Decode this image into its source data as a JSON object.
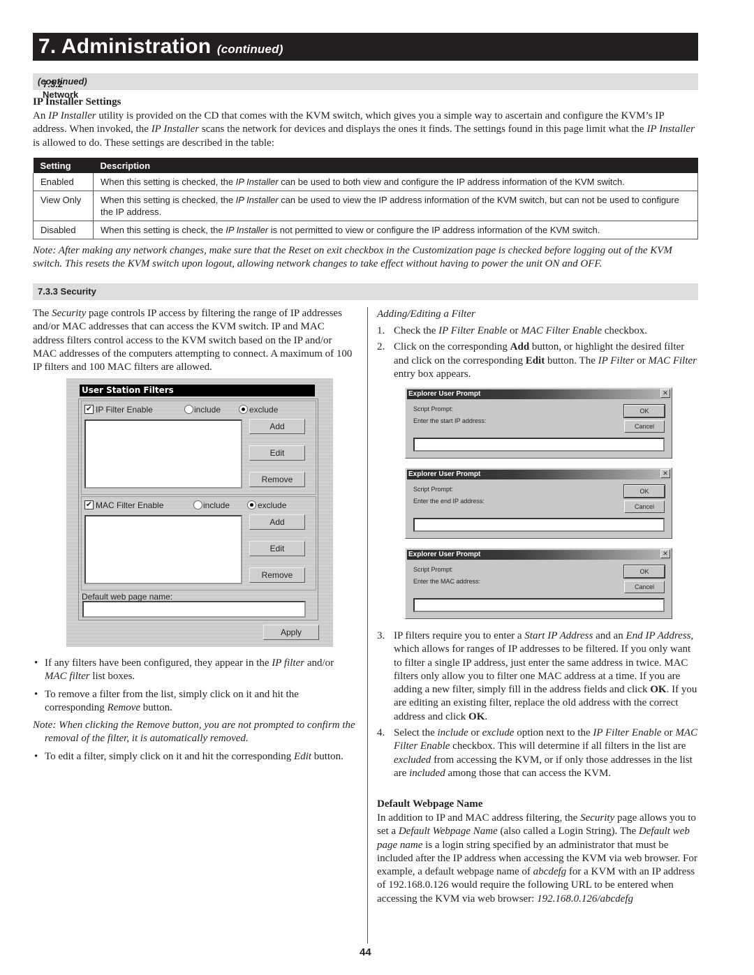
{
  "chapter": {
    "title": "7. Administration",
    "continued": "(continued)"
  },
  "network_section": {
    "number_label": "7.3.2 Network",
    "continued": "(continued)"
  },
  "ip_installer": {
    "heading": "IP Installer Settings",
    "intro": [
      {
        "t": "An "
      },
      {
        "t": "IP Installer",
        "i": true
      },
      {
        "t": " utility is provided on the CD that comes with the KVM switch, which gives you a simple way to ascertain and configure the KVM’s IP address. When invoked, the "
      },
      {
        "t": "IP Installer",
        "i": true
      },
      {
        "t": " scans the network for devices and displays the ones it finds. The settings found in this page limit what the "
      },
      {
        "t": "IP Installer",
        "i": true
      },
      {
        "t": " is allowed to do. These settings are described in the table:"
      }
    ],
    "table": {
      "headers": [
        "Setting",
        "Description"
      ],
      "rows": [
        {
          "setting": "Enabled",
          "desc": [
            {
              "t": "When this setting is checked, the "
            },
            {
              "t": "IP Installer",
              "i": true
            },
            {
              "t": " can be used to both view and configure the IP address information of the KVM switch."
            }
          ]
        },
        {
          "setting": "View Only",
          "desc": [
            {
              "t": "When this setting is checked, the "
            },
            {
              "t": "IP Installer",
              "i": true
            },
            {
              "t": " can be used to view the IP address information of the KVM switch, but can not be used to configure the IP address."
            }
          ]
        },
        {
          "setting": "Disabled",
          "desc": [
            {
              "t": "When this setting is check, the "
            },
            {
              "t": "IP Installer",
              "i": true
            },
            {
              "t": " is not permitted to view or configure the IP address information of the KVM switch."
            }
          ]
        }
      ]
    },
    "note": "Note: After making any network changes, make sure that the Reset on exit checkbox in the Customization page is checked before logging out of the KVM switch. This resets the KVM switch upon logout, allowing network changes to take effect without having to power the unit ON and OFF."
  },
  "security_section": {
    "number_label": "7.3.3 Security",
    "intro": [
      {
        "t": "The "
      },
      {
        "t": "Security",
        "i": true
      },
      {
        "t": " page controls IP access by filtering the range of IP addresses and/or MAC addresses that can access the KVM switch. IP and MAC address filters control access to the KVM switch based on the IP and/or MAC addresses of the computers attempting to connect. A maximum of 100 IP filters and 100 MAC filters are allowed."
      }
    ],
    "filters_panel": {
      "title": "User Station Filters",
      "ip": {
        "label": "IP Filter Enable",
        "checked": true,
        "include_label": "include",
        "exclude_label": "exclude",
        "selected": "exclude"
      },
      "mac": {
        "label": "MAC Filter Enable",
        "checked": true,
        "include_label": "include",
        "exclude_label": "exclude",
        "selected": "exclude"
      },
      "buttons": {
        "add": "Add",
        "edit": "Edit",
        "remove": "Remove",
        "apply": "Apply"
      },
      "check_mark": "✔",
      "web_page_label": "Default web page name:",
      "web_page_value": ""
    },
    "bullets": [
      [
        {
          "t": "If any filters have been configured, they appear in the "
        },
        {
          "t": "IP filter",
          "i": true
        },
        {
          "t": " and/or "
        },
        {
          "t": "MAC filter",
          "i": true
        },
        {
          "t": " list boxes."
        }
      ],
      [
        {
          "t": "To remove a filter from the list, simply click on it and hit the corresponding "
        },
        {
          "t": "Remove",
          "i": true
        },
        {
          "t": " button."
        }
      ]
    ],
    "remove_note": "Note: When clicking the Remove button, you are not prompted to confirm the removal of the filter, it is automatically removed.",
    "edit_bullet": [
      {
        "t": "To edit a filter, simply click on it and hit the corresponding "
      },
      {
        "t": "Edit",
        "i": true
      },
      {
        "t": " button."
      }
    ],
    "adding_heading": "Adding/Editing a Filter",
    "steps": [
      {
        "num": "1.",
        "text": [
          {
            "t": "Check the "
          },
          {
            "t": "IP Filter Enable",
            "i": true
          },
          {
            "t": " or "
          },
          {
            "t": "MAC Filter Enable",
            "i": true
          },
          {
            "t": " checkbox."
          }
        ]
      },
      {
        "num": "2.",
        "text": [
          {
            "t": "Click on the corresponding "
          },
          {
            "t": "Add",
            "b": true
          },
          {
            "t": " button, or highlight the desired filter and click on the corresponding "
          },
          {
            "t": "Edit",
            "b": true
          },
          {
            "t": " button. The "
          },
          {
            "t": "IP Filter",
            "i": true
          },
          {
            "t": " or "
          },
          {
            "t": "MAC Filter",
            "i": true
          },
          {
            "t": " entry box appears."
          }
        ]
      },
      {
        "num": "3.",
        "text": [
          {
            "t": "IP filters require you to enter a "
          },
          {
            "t": "Start IP Address",
            "i": true
          },
          {
            "t": " and an "
          },
          {
            "t": "End IP Address",
            "i": true
          },
          {
            "t": ", which allows for ranges of IP addresses to be filtered. If you only want to filter a single IP address, just enter the same address in twice. MAC filters only allow you to filter one MAC address at a time. If you are adding a new filter, simply fill in the address fields and click "
          },
          {
            "t": "OK",
            "b": true
          },
          {
            "t": ". If you are editing an existing filter, replace the old address with the correct address and click "
          },
          {
            "t": "OK",
            "b": true
          },
          {
            "t": "."
          }
        ]
      },
      {
        "num": "4.",
        "text": [
          {
            "t": "Select the "
          },
          {
            "t": "include",
            "i": true
          },
          {
            "t": " or "
          },
          {
            "t": "exclude",
            "i": true
          },
          {
            "t": " option next to the "
          },
          {
            "t": "IP Filter Enable",
            "i": true
          },
          {
            "t": " or "
          },
          {
            "t": "MAC Filter Enable",
            "i": true
          },
          {
            "t": " checkbox. This will determine if all filters in the list are "
          },
          {
            "t": "excluded",
            "i": true
          },
          {
            "t": " from accessing the KVM, or if only those addresses in the list are "
          },
          {
            "t": "included",
            "i": true
          },
          {
            "t": " among those that can access the KVM."
          }
        ]
      }
    ],
    "prompts": [
      {
        "title": "Explorer User Prompt",
        "script_label": "Script Prompt:",
        "message": "Enter the start IP address:",
        "ok": "OK",
        "cancel": "Cancel",
        "close": "✕",
        "value": ""
      },
      {
        "title": "Explorer User Prompt",
        "script_label": "Script Prompt:",
        "message": "Enter the end IP address:",
        "ok": "OK",
        "cancel": "Cancel",
        "close": "✕",
        "value": ""
      },
      {
        "title": "Explorer User Prompt",
        "script_label": "Script Prompt:",
        "message": "Enter the MAC address:",
        "ok": "OK",
        "cancel": "Cancel",
        "close": "✕",
        "value": ""
      }
    ],
    "default_webpage": {
      "heading": "Default Webpage Name",
      "body": [
        {
          "t": "In addition to IP and MAC address filtering, the "
        },
        {
          "t": "Security",
          "i": true
        },
        {
          "t": " page allows you to set a "
        },
        {
          "t": "Default Webpage Name",
          "i": true
        },
        {
          "t": " (also called a Login String). The "
        },
        {
          "t": "Default web page name",
          "i": true
        },
        {
          "t": " is a login string specified by an administrator that must be included after the IP address when accessing the KVM via web browser. For example, a default webpage name of "
        },
        {
          "t": "abcdefg",
          "i": true
        },
        {
          "t": " for a KVM with an IP address of 192.168.0.126 would require the following URL to be entered when accessing the KVM via web browser: "
        },
        {
          "t": "192.168.0.126/abcdefg",
          "i": true
        }
      ]
    }
  },
  "page_number": "44"
}
